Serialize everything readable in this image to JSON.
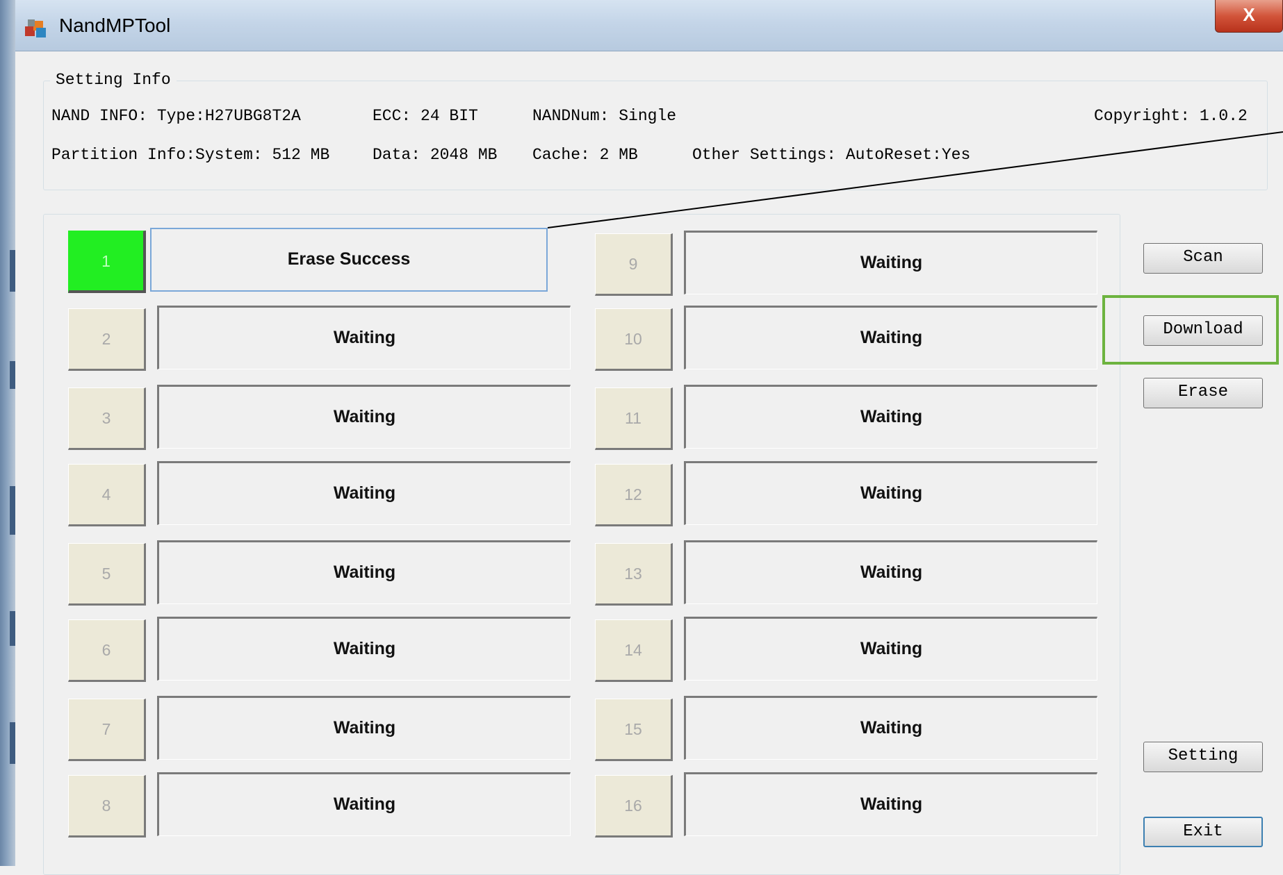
{
  "window": {
    "title": "NandMPTool",
    "close_label": "X"
  },
  "setting_info": {
    "title": "Setting Info",
    "nand_info": "NAND INFO: Type:H27UBG8T2A",
    "ecc": "ECC: 24 BIT",
    "nand_num": "NANDNum: Single",
    "copyright": "Copyright: 1.0.2",
    "partition_info": "Partition Info:System: 512 MB",
    "data": "Data: 2048 MB",
    "cache": "Cache: 2 MB",
    "other_settings": "Other Settings: AutoReset:Yes"
  },
  "slots": [
    {
      "number": "1",
      "status": "Erase Success",
      "active": true
    },
    {
      "number": "2",
      "status": "Waiting"
    },
    {
      "number": "3",
      "status": "Waiting"
    },
    {
      "number": "4",
      "status": "Waiting"
    },
    {
      "number": "5",
      "status": "Waiting"
    },
    {
      "number": "6",
      "status": "Waiting"
    },
    {
      "number": "7",
      "status": "Waiting"
    },
    {
      "number": "8",
      "status": "Waiting"
    },
    {
      "number": "9",
      "status": "Waiting"
    },
    {
      "number": "10",
      "status": "Waiting"
    },
    {
      "number": "11",
      "status": "Waiting"
    },
    {
      "number": "12",
      "status": "Waiting"
    },
    {
      "number": "13",
      "status": "Waiting"
    },
    {
      "number": "14",
      "status": "Waiting"
    },
    {
      "number": "15",
      "status": "Waiting"
    },
    {
      "number": "16",
      "status": "Waiting"
    }
  ],
  "buttons": {
    "scan": "Scan",
    "download": "Download",
    "erase": "Erase",
    "setting": "Setting",
    "exit": "Exit"
  },
  "colors": {
    "active_slot": "#22ee22",
    "highlight": "#6db33f",
    "titlebar": "#c4d5e8"
  },
  "icons": {
    "app": "app-icon",
    "close": "close-icon"
  }
}
